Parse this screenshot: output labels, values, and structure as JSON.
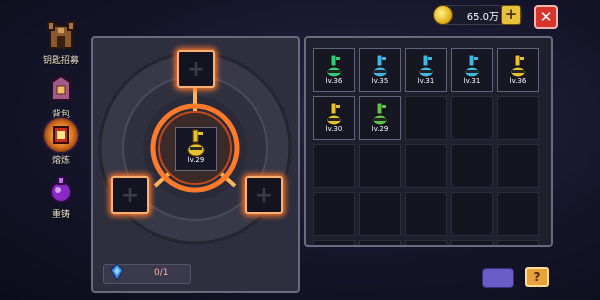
{
  "sidebar": {
    "items": [
      {
        "label": "钥匙招募",
        "icon": "castle-tower-icon"
      },
      {
        "label": "背包",
        "icon": "bag-icon"
      },
      {
        "label": "熔炼",
        "icon": "smelt-icon",
        "active": true
      },
      {
        "label": "重铸",
        "icon": "recast-potion-icon"
      }
    ]
  },
  "currency": {
    "amount": "65.0万",
    "icon": "gold-coin-icon",
    "plus": "+"
  },
  "close": {
    "label": "✕"
  },
  "forge": {
    "center_item": {
      "icon": "gold-key-icon",
      "level": "lv.29"
    },
    "slots": [
      {
        "label": "+"
      },
      {
        "label": "+"
      },
      {
        "label": "+"
      }
    ],
    "essence": {
      "value": "0/1",
      "icon": "blue-gem-icon"
    }
  },
  "inventory": {
    "items": [
      {
        "level": "lv.36",
        "icon": "green-crown-key-icon",
        "color": "#2fcf7a"
      },
      {
        "level": "lv.35",
        "icon": "blue-key-icon",
        "color": "#3fb8e6"
      },
      {
        "level": "lv.31",
        "icon": "blue-key-icon",
        "color": "#3fb8e6"
      },
      {
        "level": "lv.31",
        "icon": "blue-key-icon",
        "color": "#3fb8e6"
      },
      {
        "level": "lv.36",
        "icon": "gold-key-icon",
        "color": "#e8c22a"
      },
      {
        "level": "lv.30",
        "icon": "gold-key-icon",
        "color": "#e8c22a"
      },
      {
        "level": "lv.29",
        "icon": "green-key-icon",
        "color": "#5fc04a"
      }
    ],
    "empty_cells": 18
  },
  "bottom": {
    "help_label": "?"
  }
}
